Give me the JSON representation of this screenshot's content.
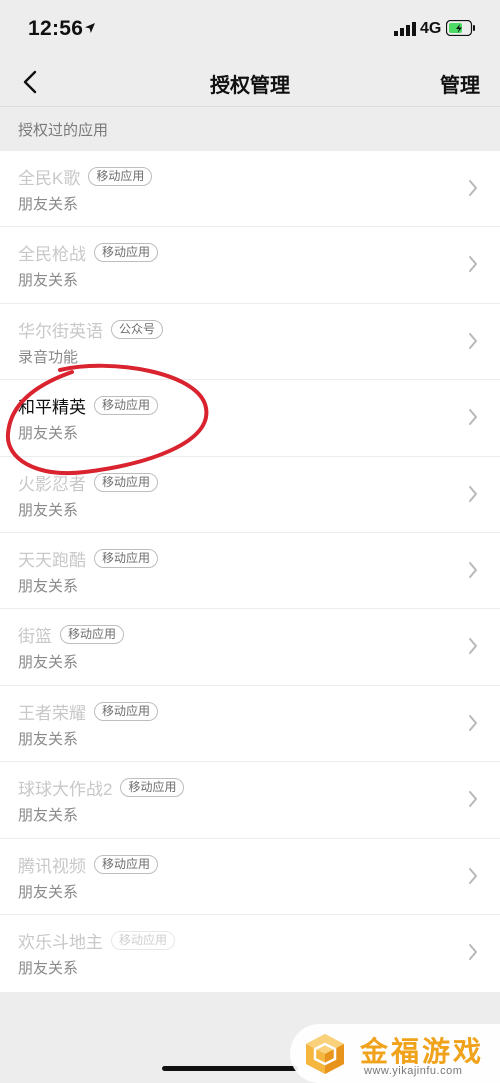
{
  "status_bar": {
    "time": "12:56",
    "network": "4G"
  },
  "nav": {
    "title": "授权管理",
    "action": "管理"
  },
  "section_header": "授权过的应用",
  "apps": [
    {
      "name": "全民K歌",
      "badge": "移动应用",
      "permission": "朋友关系",
      "faded": true
    },
    {
      "name": "全民枪战",
      "badge": "移动应用",
      "permission": "朋友关系",
      "faded": true
    },
    {
      "name": "华尔街英语",
      "badge": "公众号",
      "permission": "录音功能",
      "faded": true
    },
    {
      "name": "和平精英",
      "badge": "移动应用",
      "permission": "朋友关系",
      "faded": false
    },
    {
      "name": "火影忍者",
      "badge": "移动应用",
      "permission": "朋友关系",
      "faded": true
    },
    {
      "name": "天天跑酷",
      "badge": "移动应用",
      "permission": "朋友关系",
      "faded": true
    },
    {
      "name": "街篮",
      "badge": "移动应用",
      "permission": "朋友关系",
      "faded": true
    },
    {
      "name": "王者荣耀",
      "badge": "移动应用",
      "permission": "朋友关系",
      "faded": true
    },
    {
      "name": "球球大作战2",
      "badge": "移动应用",
      "permission": "朋友关系",
      "faded": true
    },
    {
      "name": "腾讯视频",
      "badge": "移动应用",
      "permission": "朋友关系",
      "faded": true
    },
    {
      "name": "欢乐斗地主",
      "badge": "移动应用",
      "permission": "朋友关系",
      "faded": true
    }
  ],
  "watermark": {
    "name": "金福游戏",
    "url": "www.yikajinfu.com"
  },
  "colors": {
    "background": "#ededed",
    "list_bg": "#ffffff",
    "highlight": "#d9232e",
    "watermark": "#f0a21a"
  }
}
